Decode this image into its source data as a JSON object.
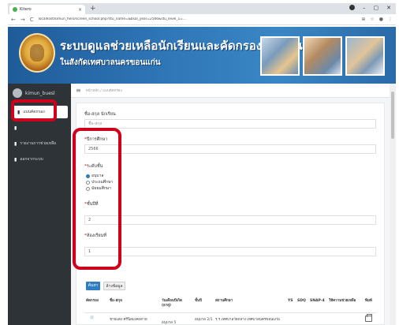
{
  "browser": {
    "tab_title": "Kitero",
    "url": "localhost/kimun_hero/screen_school.php?stu_name=&bsal_year=2566&stu_level_1=...",
    "close_glyph": "×",
    "newtab_glyph": "+",
    "back_glyph": "←",
    "forward_glyph": "→",
    "reload_glyph": "C"
  },
  "header": {
    "title_line1": "ระบบดูแลช่วยเหลือนักเรียนและคัดกรองนักเรียน",
    "title_line2": "ในสังกัดเทศบาลนครขอนแก่น"
  },
  "sidebar": {
    "username": "kimun_buesl",
    "items": [
      {
        "label": "แบบคัดกรอง",
        "icon": "file-icon",
        "active": true
      },
      {
        "label": "",
        "icon": "file-icon",
        "active": false
      },
      {
        "label": "รายงานการช่วยเหลือ",
        "icon": "file-icon",
        "active": false
      },
      {
        "label": "ออกจากระบบ",
        "icon": "file-icon",
        "active": false
      }
    ]
  },
  "topbar": {
    "breadcrumb": "หน้าหลัก / แบบคัดกรอง",
    "menu_glyph": "≡"
  },
  "form": {
    "name_label": "ชื่อ-สกุล นักเรียน",
    "name_placeholder": "ชื่อ-สกุล",
    "year_label": "ปีการศึกษา",
    "year_value": "2566",
    "level_label": "ระดับชั้น",
    "level_options": [
      "อนุบาล",
      "ประถมศึกษา",
      "มัธยมศึกษา"
    ],
    "class_label": "ชั้นปีที่",
    "class_value": "2",
    "room_label": "ห้องเรียนที่",
    "room_value": "1",
    "required_mark": "*",
    "search_button": "ค้นหา",
    "clear_button": "ล้างข้อมูล"
  },
  "table": {
    "headers": [
      "คัดกรอง",
      "ชื่อ-สกุล",
      "วันเดือนปีเกิด (อายุ)",
      "ชั้นปี",
      "สถานศึกษา",
      "YS",
      "SDQ",
      "SNAP-4",
      "ให้ความช่วยเหลือ",
      "พิมพ์"
    ],
    "rows": [
      {
        "screen": "[]",
        "name": "ชายแดง ศรีนิลมงคลกาย",
        "dob": "อนุบาล 5",
        "level": "อนุบาล 2/1",
        "school": "ร.ร.เทศบาลวัดกลาง เทศบาลนครขอนแก่น"
      }
    ]
  },
  "colors": {
    "accent": "#2f7ec1",
    "sidebar_bg": "#2e3338",
    "highlight": "#d0021b",
    "banner": "#2f76b7"
  }
}
